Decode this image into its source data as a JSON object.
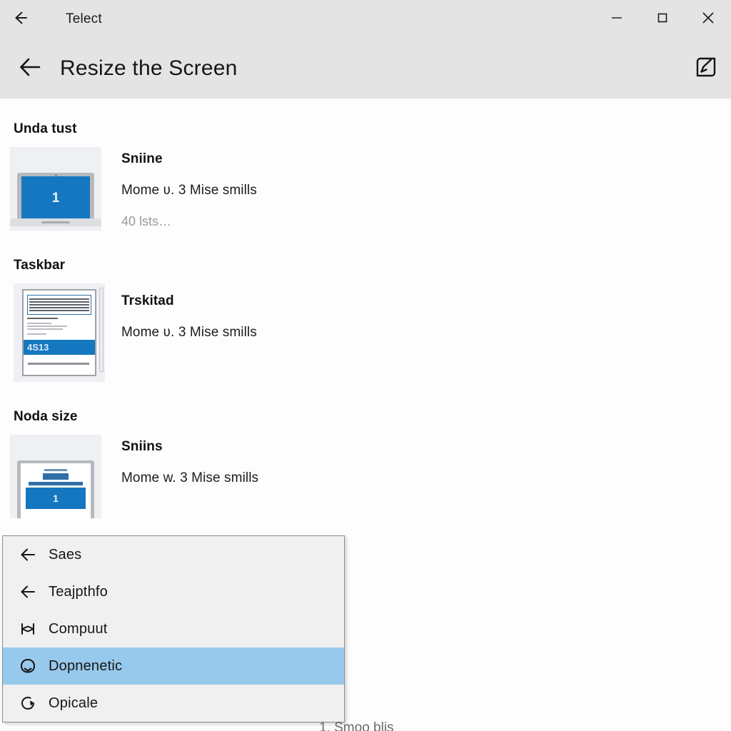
{
  "window": {
    "title": "Telect",
    "back_icon": "arrow-left-icon",
    "controls": {
      "minimize": "—",
      "maximize": "□",
      "close": "✕"
    }
  },
  "header": {
    "back_icon": "arrow-left-icon",
    "title": "Resize the Screen",
    "action_icon": "edit-square-icon"
  },
  "sections": [
    {
      "heading": "Unda tust",
      "thumbnail": "laptop-thumbnail",
      "thumbnail_screen_label": "1",
      "item_title": "Sniine",
      "item_subtitle": "Mome ʋ. 3 Mise smills",
      "item_meta": "40 lsts…"
    },
    {
      "heading": "Taskbar",
      "thumbnail": "document-thumbnail",
      "thumbnail_screen_label": "4S13",
      "item_title": "Trskitad",
      "item_subtitle": "Mome ʋ. 3 Mise smills",
      "item_meta": ""
    },
    {
      "heading": "Noda size",
      "thumbnail": "screen-chart-thumbnail",
      "thumbnail_screen_label": "1",
      "item_title": "Sniins",
      "item_subtitle": "Mome w. 3 Mise smills",
      "item_meta": ""
    }
  ],
  "context_menu": {
    "items": [
      {
        "label": "Saes",
        "icon": "arrow-left-icon",
        "selected": false
      },
      {
        "label": "Teajpthfo",
        "icon": "arrow-left-icon",
        "selected": false
      },
      {
        "label": "Compuut",
        "icon": "resize-width-icon",
        "selected": false
      },
      {
        "label": "Dopnenetic",
        "icon": "rounded-shape-icon",
        "selected": true
      },
      {
        "label": "Opicale",
        "icon": "rotate-icon",
        "selected": false
      }
    ]
  },
  "bottom_clipped_text": "1. Smoo blis",
  "colors": {
    "titlebar_bg": "#e4e4e4",
    "header_bg": "#e4e4e4",
    "content_bg": "#fdfdfd",
    "accent_blue": "#1577c0",
    "selection_blue": "#97c9ec",
    "menu_bg": "#f0f0f0",
    "muted_text": "#9a9a9a"
  }
}
